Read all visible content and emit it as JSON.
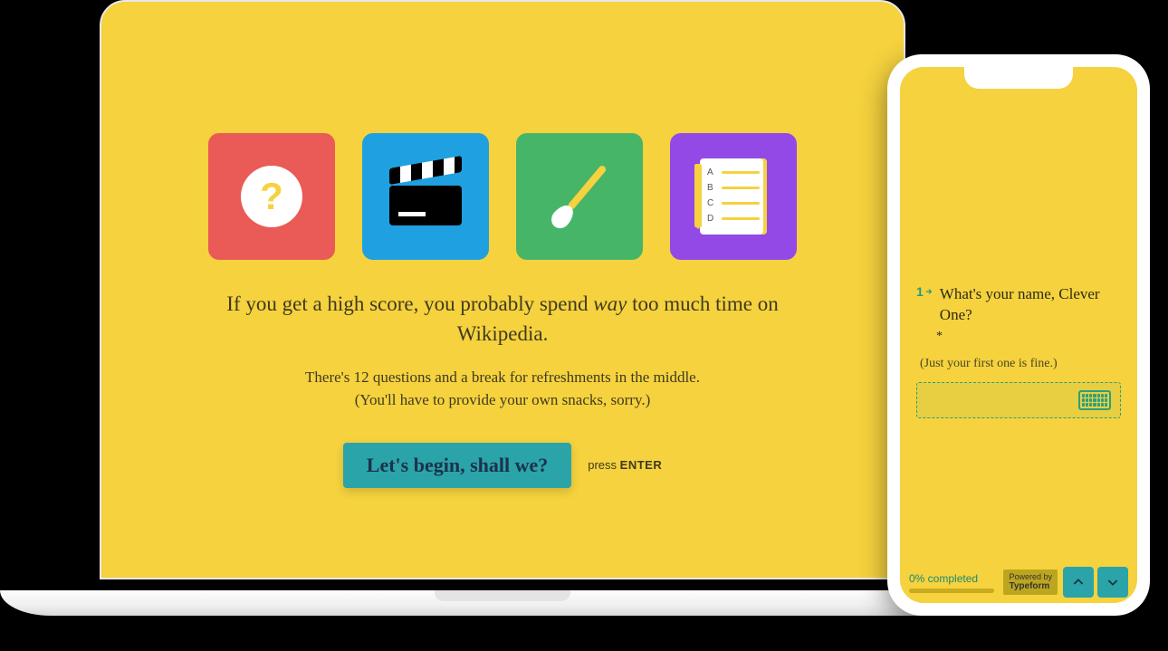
{
  "laptop": {
    "tiles": [
      {
        "name": "question-icon",
        "color": "red"
      },
      {
        "name": "clapperboard-icon",
        "color": "blue"
      },
      {
        "name": "paintbrush-icon",
        "color": "green"
      },
      {
        "name": "checklist-icon",
        "color": "purple"
      }
    ],
    "headline_pre": "If you get a high score, you probably spend ",
    "headline_em": "way",
    "headline_post": " too much time on Wikipedia.",
    "sub_line1": "There's 12 questions and a break for refreshments in the middle.",
    "sub_line2": "(You'll have to provide your own snacks, sorry.)",
    "cta_label": "Let's begin, shall we?",
    "press_hint_pre": "press ",
    "press_hint_key": "ENTER"
  },
  "phone": {
    "question_number": "1",
    "question_text": "What's your name, Clever One?",
    "required_marker": "*",
    "help_text": "(Just your first one is fine.)",
    "progress_label": "0% completed",
    "powered_pre": "Powered by",
    "powered_brand": "Typeform",
    "list_letters": [
      "A",
      "B",
      "C",
      "D"
    ]
  }
}
